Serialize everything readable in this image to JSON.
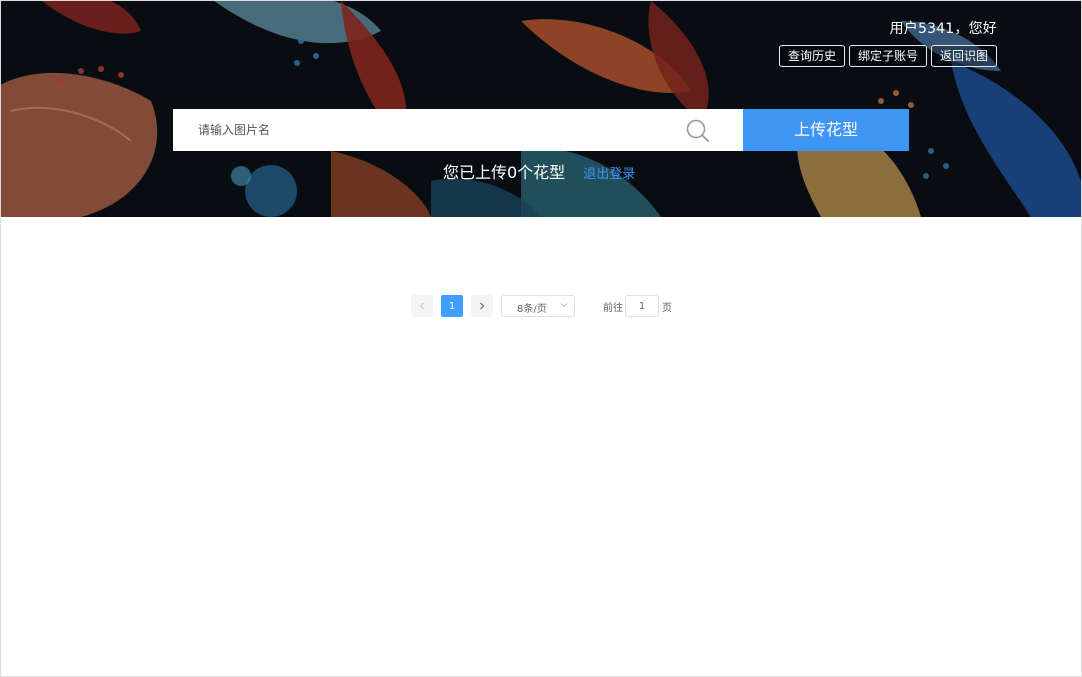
{
  "header": {
    "greeting": "用户5341，您好",
    "buttons": [
      "查询历史",
      "绑定子账号",
      "返回识图"
    ]
  },
  "search": {
    "placeholder": "请输入图片名",
    "value": ""
  },
  "upload": {
    "button_label": "上传花型",
    "status_text": "您已上传0个花型",
    "logout_label": "退出登录"
  },
  "pagination": {
    "current_page": "1",
    "page_size": "8条/页",
    "jump_label": "前往",
    "jump_value": "1",
    "jump_suffix": "页"
  },
  "colors": {
    "accent": "#3f95f4",
    "banner_bg": "#0b1016",
    "page_active": "#409eff"
  },
  "icons": {
    "search": "search-icon",
    "prev": "chevron-left-icon",
    "next": "chevron-right-icon",
    "dropdown": "chevron-down-icon"
  }
}
